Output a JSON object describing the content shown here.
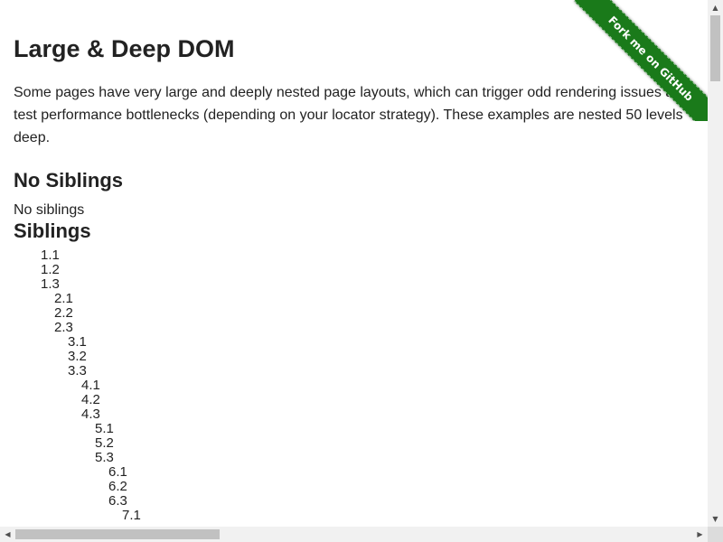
{
  "page": {
    "title": "Large & Deep DOM",
    "intro": "Some pages have very large and deeply nested page layouts, which can trigger odd rendering issues and test performance bottlenecks (depending on your locator strategy). These examples are nested 50 levels deep.",
    "no_siblings_heading": "No Siblings",
    "no_siblings_text": "No siblings",
    "siblings_heading": "Siblings"
  },
  "ribbon": {
    "label": "Fork me on GitHub",
    "color": "#1a7a1a"
  },
  "siblings": [
    {
      "level": 1,
      "items": [
        "1.1",
        "1.2",
        "1.3"
      ]
    },
    {
      "level": 2,
      "items": [
        "2.1",
        "2.2",
        "2.3"
      ]
    },
    {
      "level": 3,
      "items": [
        "3.1",
        "3.2",
        "3.3"
      ]
    },
    {
      "level": 4,
      "items": [
        "4.1",
        "4.2",
        "4.3"
      ]
    },
    {
      "level": 5,
      "items": [
        "5.1",
        "5.2",
        "5.3"
      ]
    },
    {
      "level": 6,
      "items": [
        "6.1",
        "6.2",
        "6.3"
      ]
    },
    {
      "level": 7,
      "items": [
        "7.1"
      ]
    }
  ],
  "scrollbar": {
    "vertical_arrow_up": "▲",
    "vertical_arrow_down": "▼",
    "horizontal_arrow_left": "◀",
    "horizontal_arrow_right": "▶"
  }
}
